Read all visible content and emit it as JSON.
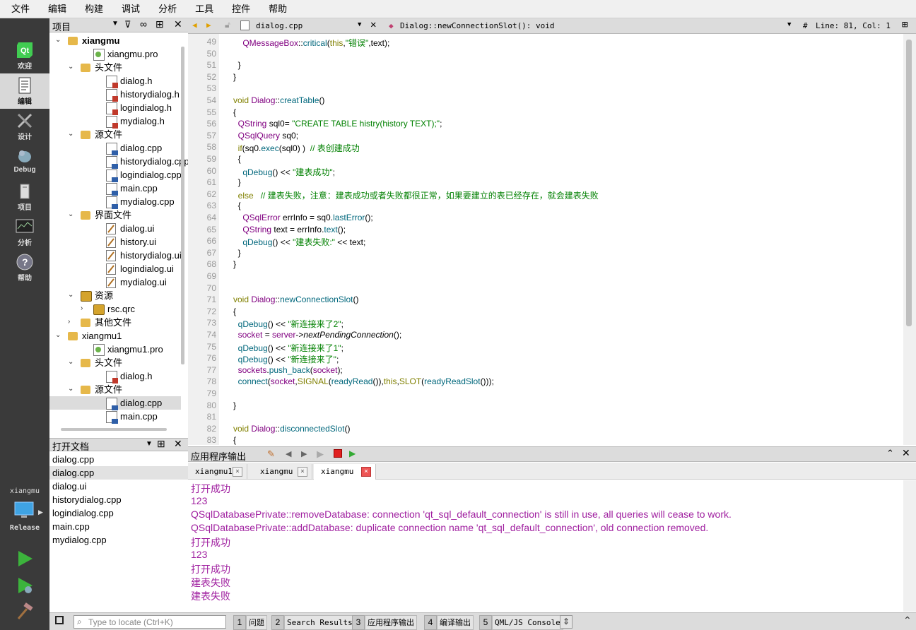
{
  "menu": [
    "文件",
    "编辑",
    "构建",
    "调试",
    "分析",
    "工具",
    "控件",
    "帮助"
  ],
  "modes": [
    {
      "label": "欢迎",
      "icon": "qt-logo-icon"
    },
    {
      "label": "编辑",
      "icon": "edit-document-icon"
    },
    {
      "label": "设计",
      "icon": "design-tools-icon"
    },
    {
      "label": "Debug",
      "icon": "debug-bug-icon"
    },
    {
      "label": "项目",
      "icon": "project-wrench-icon"
    },
    {
      "label": "分析",
      "icon": "analyze-monitor-icon"
    },
    {
      "label": "帮助",
      "icon": "help-question-icon"
    }
  ],
  "kit": {
    "project": "xiangmu",
    "config": "Release"
  },
  "project_pane": {
    "title": "项目"
  },
  "tree": [
    {
      "t": "xiangmu",
      "d": 0,
      "k": "proj",
      "bold": true,
      "exp": "v"
    },
    {
      "t": "xiangmu.pro",
      "d": 2,
      "k": "pro"
    },
    {
      "t": "头文件",
      "d": 1,
      "k": "folder",
      "exp": "v"
    },
    {
      "t": "dialog.h",
      "d": 3,
      "k": "hdr"
    },
    {
      "t": "historydialog.h",
      "d": 3,
      "k": "hdr"
    },
    {
      "t": "logindialog.h",
      "d": 3,
      "k": "hdr"
    },
    {
      "t": "mydialog.h",
      "d": 3,
      "k": "hdr"
    },
    {
      "t": "源文件",
      "d": 1,
      "k": "folder",
      "exp": "v"
    },
    {
      "t": "dialog.cpp",
      "d": 3,
      "k": "cpp"
    },
    {
      "t": "historydialog.cpp",
      "d": 3,
      "k": "cpp"
    },
    {
      "t": "logindialog.cpp",
      "d": 3,
      "k": "cpp"
    },
    {
      "t": "main.cpp",
      "d": 3,
      "k": "cpp"
    },
    {
      "t": "mydialog.cpp",
      "d": 3,
      "k": "cpp"
    },
    {
      "t": "界面文件",
      "d": 1,
      "k": "folder",
      "exp": "v"
    },
    {
      "t": "dialog.ui",
      "d": 3,
      "k": "ui"
    },
    {
      "t": "history.ui",
      "d": 3,
      "k": "ui"
    },
    {
      "t": "historydialog.ui",
      "d": 3,
      "k": "ui"
    },
    {
      "t": "logindialog.ui",
      "d": 3,
      "k": "ui"
    },
    {
      "t": "mydialog.ui",
      "d": 3,
      "k": "ui"
    },
    {
      "t": "资源",
      "d": 1,
      "k": "lock",
      "exp": "v"
    },
    {
      "t": "rsc.qrc",
      "d": 2,
      "k": "lock",
      "exp": ">"
    },
    {
      "t": "其他文件",
      "d": 1,
      "k": "folder",
      "exp": ">"
    },
    {
      "t": "xiangmu1",
      "d": 0,
      "k": "proj",
      "exp": "v"
    },
    {
      "t": "xiangmu1.pro",
      "d": 2,
      "k": "pro"
    },
    {
      "t": "头文件",
      "d": 1,
      "k": "folder",
      "exp": "v"
    },
    {
      "t": "dialog.h",
      "d": 3,
      "k": "hdr"
    },
    {
      "t": "源文件",
      "d": 1,
      "k": "folder",
      "exp": "v"
    },
    {
      "t": "dialog.cpp",
      "d": 3,
      "k": "cpp",
      "sel": true
    },
    {
      "t": "main.cpp",
      "d": 3,
      "k": "cpp"
    }
  ],
  "open_docs": {
    "title": "打开文档",
    "items": [
      "dialog.cpp",
      "dialog.cpp",
      "dialog.ui",
      "historydialog.cpp",
      "logindialog.cpp",
      "main.cpp",
      "mydialog.cpp"
    ],
    "selected": 1
  },
  "editor": {
    "file": "dialog.cpp",
    "symbol": "Dialog::newConnectionSlot(): void",
    "position": "Line: 81, Col: 1",
    "hash": "#",
    "lines": [
      {
        "n": "49",
        "f": "",
        "c": [
          [
            "    ",
            ""
          ],
          [
            "QMessageBox",
            "ty"
          ],
          [
            "::",
            "",
            ""
          ],
          [
            "critical",
            "fn"
          ],
          [
            "(",
            ""
          ],
          [
            "this",
            "kw"
          ],
          [
            ",",
            ""
          ],
          [
            "\"错误\"",
            "st"
          ],
          [
            ",text);",
            ""
          ]
        ]
      },
      {
        "n": "50",
        "f": "",
        "c": []
      },
      {
        "n": "51",
        "f": "",
        "c": [
          [
            "  }",
            ""
          ]
        ]
      },
      {
        "n": "52",
        "f": "",
        "c": [
          [
            "}",
            ""
          ]
        ]
      },
      {
        "n": "53",
        "f": "",
        "c": []
      },
      {
        "n": "54",
        "f": "v",
        "c": [
          [
            "void ",
            "kw"
          ],
          [
            "Dialog",
            "ty"
          ],
          [
            "::",
            ""
          ],
          [
            "creatTable",
            "fn"
          ],
          [
            "()",
            ""
          ]
        ]
      },
      {
        "n": "55",
        "f": "",
        "c": [
          [
            "{",
            ""
          ]
        ]
      },
      {
        "n": "56",
        "f": "",
        "c": [
          [
            "  ",
            ""
          ],
          [
            "QString",
            "ty"
          ],
          [
            " sql0= ",
            ""
          ],
          [
            "\"CREATE TABLE histry(history TEXT);\"",
            "st"
          ],
          [
            ";",
            ""
          ]
        ]
      },
      {
        "n": "57",
        "f": "",
        "c": [
          [
            "  ",
            ""
          ],
          [
            "QSqlQuery",
            "ty"
          ],
          [
            " sq0;",
            ""
          ]
        ]
      },
      {
        "n": "58",
        "f": "v",
        "c": [
          [
            "  ",
            ""
          ],
          [
            "if",
            "kw"
          ],
          [
            "(sq0.",
            ""
          ],
          [
            "exec",
            "fn"
          ],
          [
            "(sql0) )  ",
            ""
          ],
          [
            "// 表创建成功",
            "cm"
          ]
        ]
      },
      {
        "n": "59",
        "f": "",
        "c": [
          [
            "  {",
            ""
          ]
        ]
      },
      {
        "n": "60",
        "f": "",
        "c": [
          [
            "    ",
            ""
          ],
          [
            "qDebug",
            "fn"
          ],
          [
            "() << ",
            ""
          ],
          [
            "\"建表成功\"",
            "st"
          ],
          [
            ";",
            ""
          ]
        ]
      },
      {
        "n": "61",
        "f": "",
        "c": [
          [
            "  }",
            ""
          ]
        ]
      },
      {
        "n": "62",
        "f": "v",
        "c": [
          [
            "  ",
            ""
          ],
          [
            "else",
            "kw"
          ],
          [
            "   ",
            ""
          ],
          [
            "// 建表失败，注意：建表成功或者失败都很正常，如果要建立的表已经存在，就会建表失败",
            "cm"
          ]
        ]
      },
      {
        "n": "63",
        "f": "",
        "c": [
          [
            "  {",
            ""
          ]
        ]
      },
      {
        "n": "64",
        "f": "",
        "c": [
          [
            "    ",
            ""
          ],
          [
            "QSqlError",
            "ty"
          ],
          [
            " errInfo = sq0.",
            ""
          ],
          [
            "lastError",
            "fn"
          ],
          [
            "();",
            ""
          ]
        ]
      },
      {
        "n": "65",
        "f": "",
        "c": [
          [
            "    ",
            ""
          ],
          [
            "QString",
            "ty"
          ],
          [
            " text = errInfo.",
            ""
          ],
          [
            "text",
            "fn"
          ],
          [
            "();",
            ""
          ]
        ]
      },
      {
        "n": "66",
        "f": "",
        "c": [
          [
            "    ",
            ""
          ],
          [
            "qDebug",
            "fn"
          ],
          [
            "() << ",
            ""
          ],
          [
            "\"建表失败:\"",
            "st"
          ],
          [
            " << text;",
            ""
          ]
        ]
      },
      {
        "n": "67",
        "f": "",
        "c": [
          [
            "  }",
            ""
          ]
        ]
      },
      {
        "n": "68",
        "f": "",
        "c": [
          [
            "}",
            ""
          ]
        ]
      },
      {
        "n": "69",
        "f": "",
        "c": []
      },
      {
        "n": "70",
        "f": "",
        "c": []
      },
      {
        "n": "71",
        "f": "v",
        "c": [
          [
            "void ",
            "kw"
          ],
          [
            "Dialog",
            "ty"
          ],
          [
            "::",
            ""
          ],
          [
            "newConnectionSlot",
            "fn"
          ],
          [
            "()",
            ""
          ]
        ]
      },
      {
        "n": "72",
        "f": "",
        "c": [
          [
            "{",
            ""
          ]
        ]
      },
      {
        "n": "73",
        "f": "",
        "c": [
          [
            "  ",
            ""
          ],
          [
            "qDebug",
            "fn"
          ],
          [
            "() << ",
            ""
          ],
          [
            "\"新连接来了2\"",
            "st"
          ],
          [
            ";",
            ""
          ]
        ]
      },
      {
        "n": "74",
        "f": "",
        "c": [
          [
            "  ",
            ""
          ],
          [
            "socket",
            "ty"
          ],
          [
            " = ",
            ""
          ],
          [
            "server",
            "ty"
          ],
          [
            "->",
            ""
          ],
          [
            "nextPendingConnection",
            "it"
          ],
          [
            "();",
            ""
          ]
        ]
      },
      {
        "n": "75",
        "f": "",
        "c": [
          [
            "  ",
            ""
          ],
          [
            "qDebug",
            "fn"
          ],
          [
            "() << ",
            ""
          ],
          [
            "\"新连接来了1\"",
            "st"
          ],
          [
            ";",
            ""
          ]
        ]
      },
      {
        "n": "76",
        "f": "",
        "c": [
          [
            "  ",
            ""
          ],
          [
            "qDebug",
            "fn"
          ],
          [
            "() << ",
            ""
          ],
          [
            "\"新连接来了\"",
            "st"
          ],
          [
            ";",
            ""
          ]
        ]
      },
      {
        "n": "77",
        "f": "",
        "c": [
          [
            "  ",
            ""
          ],
          [
            "sockets",
            "ty"
          ],
          [
            ".",
            ""
          ],
          [
            "push_back",
            "fn"
          ],
          [
            "(",
            ""
          ],
          [
            "socket",
            "ty"
          ],
          [
            ");",
            ""
          ]
        ]
      },
      {
        "n": "78",
        "f": "",
        "c": [
          [
            "  ",
            ""
          ],
          [
            "connect",
            "fn"
          ],
          [
            "(",
            ""
          ],
          [
            "socket",
            "ty"
          ],
          [
            ",",
            ""
          ],
          [
            "SIGNAL",
            "kw"
          ],
          [
            "(",
            ""
          ],
          [
            "readyRead",
            "fn"
          ],
          [
            "()),",
            ""
          ],
          [
            "this",
            "kw"
          ],
          [
            ",",
            ""
          ],
          [
            "SLOT",
            "kw"
          ],
          [
            "(",
            ""
          ],
          [
            "readyReadSlot",
            "fn"
          ],
          [
            "()));",
            ""
          ]
        ]
      },
      {
        "n": "79",
        "f": "",
        "c": []
      },
      {
        "n": "80",
        "f": "",
        "c": [
          [
            "}",
            ""
          ]
        ]
      },
      {
        "n": "81",
        "f": "",
        "c": []
      },
      {
        "n": "82",
        "f": "v",
        "c": [
          [
            "void ",
            "kw"
          ],
          [
            "Dialog",
            "ty"
          ],
          [
            "::",
            ""
          ],
          [
            "disconnectedSlot",
            "fn"
          ],
          [
            "()",
            ""
          ]
        ]
      },
      {
        "n": "83",
        "f": "",
        "c": [
          [
            "{",
            ""
          ]
        ]
      }
    ]
  },
  "output": {
    "title": "应用程序输出",
    "tabs": [
      "xiangmu1",
      "xiangmu",
      "xiangmu"
    ],
    "active_tab": 2,
    "lines": [
      "打开成功",
      "123",
      "QSqlDatabasePrivate::removeDatabase: connection 'qt_sql_default_connection' is still in use, all queries will cease to work.",
      "QSqlDatabasePrivate::addDatabase: duplicate connection name 'qt_sql_default_connection', old connection removed.",
      "打开成功",
      "123",
      "打开成功",
      "建表失败",
      "建表失败"
    ]
  },
  "statusbar": {
    "locate_placeholder": "Type to locate (Ctrl+K)",
    "panes": [
      {
        "num": "1",
        "name": "问题"
      },
      {
        "num": "2",
        "name": "Search Results"
      },
      {
        "num": "3",
        "name": "应用程序输出"
      },
      {
        "num": "4",
        "name": "编译输出"
      },
      {
        "num": "5",
        "name": "QML/JS Console"
      }
    ]
  },
  "colors": {
    "accent_output": "#a020a0",
    "string": "#008000",
    "type": "#800080",
    "keyword": "#808000"
  }
}
